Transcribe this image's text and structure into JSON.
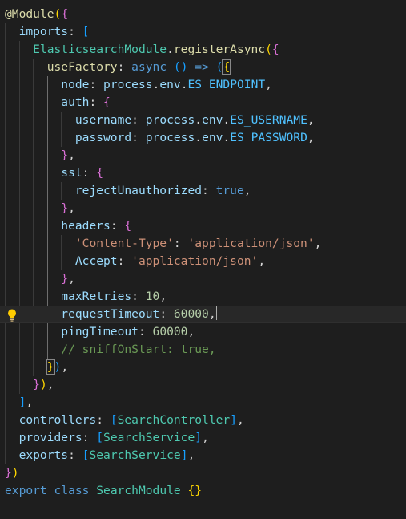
{
  "editor": {
    "lines": [
      [
        {
          "t": "@",
          "c": "dec"
        },
        {
          "t": "Module",
          "c": "dec"
        },
        {
          "t": "(",
          "c": "b1"
        },
        {
          "t": "{",
          "c": "b2"
        }
      ],
      [
        {
          "t": "  "
        },
        {
          "t": "imports",
          "c": "prop"
        },
        {
          "t": ": ",
          "c": "pun"
        },
        {
          "t": "[",
          "c": "b3"
        }
      ],
      [
        {
          "t": "    "
        },
        {
          "t": "ElasticsearchModule",
          "c": "cls"
        },
        {
          "t": ".",
          "c": "pun"
        },
        {
          "t": "registerAsync",
          "c": "fn"
        },
        {
          "t": "(",
          "c": "b1"
        },
        {
          "t": "{",
          "c": "b2"
        }
      ],
      [
        {
          "t": "      "
        },
        {
          "t": "useFactory",
          "c": "fn"
        },
        {
          "t": ": ",
          "c": "pun"
        },
        {
          "t": "async",
          "c": "kw"
        },
        {
          "t": " ",
          "c": "pun"
        },
        {
          "t": "()",
          "c": "b3"
        },
        {
          "t": " ",
          "c": "pun"
        },
        {
          "t": "=>",
          "c": "kw"
        },
        {
          "t": " ",
          "c": "pun"
        },
        {
          "t": "(",
          "c": "b3"
        },
        {
          "t": "{",
          "c": "b1",
          "m": 1
        }
      ],
      [
        {
          "t": "        "
        },
        {
          "t": "node",
          "c": "prop"
        },
        {
          "t": ": ",
          "c": "pun"
        },
        {
          "t": "process",
          "c": "var"
        },
        {
          "t": ".",
          "c": "pun"
        },
        {
          "t": "env",
          "c": "var"
        },
        {
          "t": ".",
          "c": "pun"
        },
        {
          "t": "ES_ENDPOINT",
          "c": "const"
        },
        {
          "t": ",",
          "c": "pun"
        }
      ],
      [
        {
          "t": "        "
        },
        {
          "t": "auth",
          "c": "prop"
        },
        {
          "t": ": ",
          "c": "pun"
        },
        {
          "t": "{",
          "c": "b2"
        }
      ],
      [
        {
          "t": "          "
        },
        {
          "t": "username",
          "c": "prop"
        },
        {
          "t": ": ",
          "c": "pun"
        },
        {
          "t": "process",
          "c": "var"
        },
        {
          "t": ".",
          "c": "pun"
        },
        {
          "t": "env",
          "c": "var"
        },
        {
          "t": ".",
          "c": "pun"
        },
        {
          "t": "ES_USERNAME",
          "c": "const"
        },
        {
          "t": ",",
          "c": "pun"
        }
      ],
      [
        {
          "t": "          "
        },
        {
          "t": "password",
          "c": "prop"
        },
        {
          "t": ": ",
          "c": "pun"
        },
        {
          "t": "process",
          "c": "var"
        },
        {
          "t": ".",
          "c": "pun"
        },
        {
          "t": "env",
          "c": "var"
        },
        {
          "t": ".",
          "c": "pun"
        },
        {
          "t": "ES_PASSWORD",
          "c": "const"
        },
        {
          "t": ",",
          "c": "pun"
        }
      ],
      [
        {
          "t": "        "
        },
        {
          "t": "}",
          "c": "b2"
        },
        {
          "t": ",",
          "c": "pun"
        }
      ],
      [
        {
          "t": "        "
        },
        {
          "t": "ssl",
          "c": "prop"
        },
        {
          "t": ": ",
          "c": "pun"
        },
        {
          "t": "{",
          "c": "b2"
        }
      ],
      [
        {
          "t": "          "
        },
        {
          "t": "rejectUnauthorized",
          "c": "prop"
        },
        {
          "t": ": ",
          "c": "pun"
        },
        {
          "t": "true",
          "c": "kw"
        },
        {
          "t": ",",
          "c": "pun"
        }
      ],
      [
        {
          "t": "        "
        },
        {
          "t": "}",
          "c": "b2"
        },
        {
          "t": ",",
          "c": "pun"
        }
      ],
      [
        {
          "t": "        "
        },
        {
          "t": "headers",
          "c": "prop"
        },
        {
          "t": ": ",
          "c": "pun"
        },
        {
          "t": "{",
          "c": "b2"
        }
      ],
      [
        {
          "t": "          "
        },
        {
          "t": "'Content-Type'",
          "c": "str"
        },
        {
          "t": ": ",
          "c": "pun"
        },
        {
          "t": "'application/json'",
          "c": "str"
        },
        {
          "t": ",",
          "c": "pun"
        }
      ],
      [
        {
          "t": "          "
        },
        {
          "t": "Accept",
          "c": "prop"
        },
        {
          "t": ": ",
          "c": "pun"
        },
        {
          "t": "'application/json'",
          "c": "str"
        },
        {
          "t": ",",
          "c": "pun"
        }
      ],
      [
        {
          "t": "        "
        },
        {
          "t": "}",
          "c": "b2"
        },
        {
          "t": ",",
          "c": "pun"
        }
      ],
      [
        {
          "t": "        "
        },
        {
          "t": "maxRetries",
          "c": "prop"
        },
        {
          "t": ": ",
          "c": "pun"
        },
        {
          "t": "10",
          "c": "num"
        },
        {
          "t": ",",
          "c": "pun"
        }
      ],
      [
        {
          "t": "        "
        },
        {
          "t": "requestTimeout",
          "c": "prop"
        },
        {
          "t": ": ",
          "c": "pun"
        },
        {
          "t": "60000",
          "c": "num"
        },
        {
          "t": ",",
          "c": "pun"
        }
      ],
      [
        {
          "t": "        "
        },
        {
          "t": "pingTimeout",
          "c": "prop"
        },
        {
          "t": ": ",
          "c": "pun"
        },
        {
          "t": "60000",
          "c": "num"
        },
        {
          "t": ",",
          "c": "pun"
        }
      ],
      [
        {
          "t": "        "
        },
        {
          "t": "// sniffOnStart: true,",
          "c": "com"
        }
      ],
      [
        {
          "t": "      "
        },
        {
          "t": "}",
          "c": "b1",
          "m": 1
        },
        {
          "t": ")",
          "c": "b3"
        },
        {
          "t": ",",
          "c": "pun"
        }
      ],
      [
        {
          "t": "    "
        },
        {
          "t": "}",
          "c": "b2"
        },
        {
          "t": ")",
          "c": "b1"
        },
        {
          "t": ",",
          "c": "pun"
        }
      ],
      [
        {
          "t": "  "
        },
        {
          "t": "]",
          "c": "b3"
        },
        {
          "t": ",",
          "c": "pun"
        }
      ],
      [
        {
          "t": "  "
        },
        {
          "t": "controllers",
          "c": "prop"
        },
        {
          "t": ": ",
          "c": "pun"
        },
        {
          "t": "[",
          "c": "b3"
        },
        {
          "t": "SearchController",
          "c": "cls"
        },
        {
          "t": "]",
          "c": "b3"
        },
        {
          "t": ",",
          "c": "pun"
        }
      ],
      [
        {
          "t": "  "
        },
        {
          "t": "providers",
          "c": "prop"
        },
        {
          "t": ": ",
          "c": "pun"
        },
        {
          "t": "[",
          "c": "b3"
        },
        {
          "t": "SearchService",
          "c": "cls"
        },
        {
          "t": "]",
          "c": "b3"
        },
        {
          "t": ",",
          "c": "pun"
        }
      ],
      [
        {
          "t": "  "
        },
        {
          "t": "exports",
          "c": "prop"
        },
        {
          "t": ": ",
          "c": "pun"
        },
        {
          "t": "[",
          "c": "b3"
        },
        {
          "t": "SearchService",
          "c": "cls"
        },
        {
          "t": "]",
          "c": "b3"
        },
        {
          "t": ",",
          "c": "pun"
        }
      ],
      [
        {
          "t": "}",
          "c": "b2"
        },
        {
          "t": ")",
          "c": "b1"
        }
      ],
      [
        {
          "t": "export",
          "c": "kw"
        },
        {
          "t": " ",
          "c": "pun"
        },
        {
          "t": "class",
          "c": "kw"
        },
        {
          "t": " ",
          "c": "pun"
        },
        {
          "t": "SearchModule",
          "c": "cls"
        },
        {
          "t": " ",
          "c": "pun"
        },
        {
          "t": "{}",
          "c": "b1"
        }
      ]
    ],
    "cursor_line": 17,
    "lightbulb_line": 17,
    "colors": {
      "background": "#1e1e1e",
      "current_line": "#282828",
      "bracket_gold": "#ffd700",
      "bracket_orchid": "#da70d6",
      "bracket_blue": "#179fff"
    },
    "icons": [
      "lightbulb-icon"
    ]
  }
}
